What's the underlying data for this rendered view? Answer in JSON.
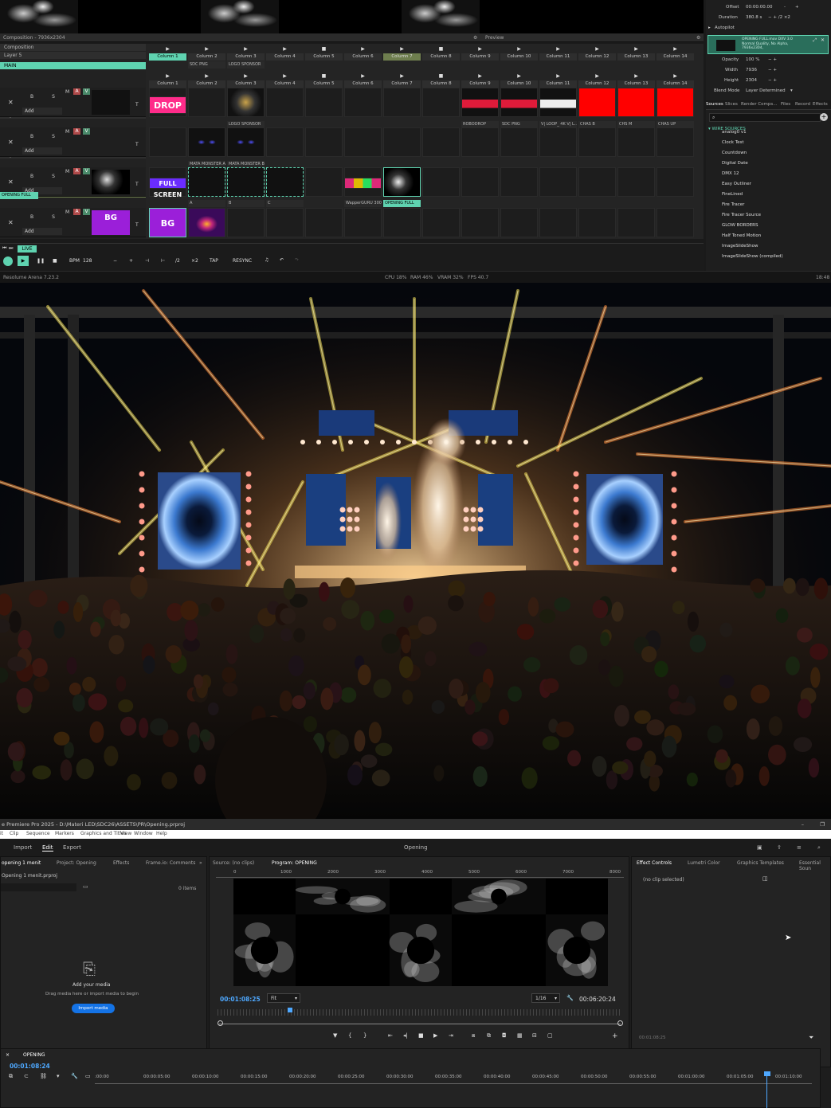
{
  "resolume": {
    "composition_title": "Composition - 7936x2304",
    "preview_label": "Preview",
    "composition_label": "Composition",
    "layers": [
      {
        "bar": "Layer 5",
        "type": "normal"
      },
      {
        "bar": "MAIN",
        "type": "main"
      },
      {
        "bar": "Layer 4",
        "type": "normal"
      },
      {
        "bar": "Layer 3",
        "type": "normal"
      },
      {
        "bar": "Layer 2",
        "type": "l2"
      }
    ],
    "layer_controls": {
      "b": "B",
      "s": "S",
      "x": "✕",
      "add": "Add",
      "m": "M",
      "a": "A",
      "v": "V",
      "t": "T",
      "alph": "Alph"
    },
    "columns": [
      "Column 1",
      "Column 2",
      "Column 3",
      "Column 4",
      "Column 5",
      "Column 6",
      "Column 7",
      "Column 8",
      "Column 9",
      "Column 10",
      "Column 11",
      "Column 12",
      "Column 13",
      "Column 14"
    ],
    "clip_labels_row0": [
      "",
      "SDC PNG",
      "LOGO SPONSOR"
    ],
    "clip_labels_row1": [
      "",
      "",
      "LOGO SPONSOR",
      "",
      "",
      "",
      "",
      "",
      "ROBODROP",
      "SDC PNG",
      "V| LOOP_ 4K V| L...",
      "CHAS B",
      "CHS M",
      "CHAS UP"
    ],
    "clip_labels_row2": [
      "",
      "MATA MONSTER A",
      "MATA MONSTER B"
    ],
    "clip_labels_row3": [
      "",
      "A",
      "B",
      "C",
      "",
      "WapperGURU 300...",
      "OPENING FULL"
    ],
    "clip_text": {
      "drop": "DROP",
      "fullscreen": "FULL SCREEN",
      "bg": "BG"
    },
    "layer_thumbs": {
      "opening_full": "OPENING FULL",
      "bg": "BG"
    },
    "transport": {
      "live": "LIVE",
      "bpm_label": "BPM",
      "bpm": "128",
      "minus": "−",
      "plus": "+",
      "div2": "/2",
      "x2": "×2",
      "tap": "TAP",
      "resync": "RESYNC"
    },
    "status": {
      "version": "Resolume Arena 7.23.2",
      "cpu": "CPU 18%",
      "ram": "RAM 46%",
      "vram": "VRAM 32%",
      "fps": "FPS 40.7",
      "time": "18:48"
    },
    "right_panel": {
      "offset_label": "Offset",
      "offset": "00:00:00.00",
      "duration_label": "Duration",
      "duration": "380.8 s",
      "autopilot": "Autopilot",
      "clip_info": "OPENING FULL.mov DXV 3.0 Normal Quality, No Alpha, 7936x2304,",
      "opacity_label": "Opacity",
      "opacity": "100 %",
      "width_label": "Width",
      "width": "7936",
      "height_label": "Height",
      "height": "2304",
      "blend_label": "Blend Mode",
      "blend": "Layer Determined",
      "tabs": [
        "Sources",
        "Slices",
        "Render Comps...",
        "Files",
        "Record",
        "Effects"
      ],
      "group": "WIRE SOURCES",
      "sources": [
        "analog0 v1",
        "Clock Test",
        "Countdown",
        "Digital Date",
        "DMX 12",
        "Easy Outliner",
        "FineLined",
        "Fire Tracer",
        "Fire Tracer Source",
        "GLOW BORDERS",
        "Half Toned Motion",
        "ImageSlideShow",
        "ImageSlideShow (compiled)"
      ]
    }
  },
  "premiere": {
    "title": "e Premiere Pro 2025 - D:\\Materi LED\\SDC26\\ASSETS\\PR\\Opening.prproj",
    "menu": [
      "it",
      "Clip",
      "Sequence",
      "Markers",
      "Graphics and Titles",
      "View",
      "Window",
      "Help"
    ],
    "header_tabs": [
      "Import",
      "Edit",
      "Export"
    ],
    "project_name": "Opening",
    "left_tabs": [
      "opening 1 menit",
      "Project: Opening",
      "Effects",
      "Frame.io: Comments"
    ],
    "project_file": "Opening 1 menit.prproj",
    "items": "0 items",
    "add_media": "Add your media",
    "drag_hint": "Drag media here or import media to begin",
    "import_button": "Import media",
    "source_tab": "Source: (no clips)",
    "program_tab": "Program: OPENING",
    "program_timecode": "00:01:08:25",
    "fit": "Fit",
    "resolution": "1/16",
    "duration_tc": "00:06:20:24",
    "ruler": [
      "0",
      "1000",
      "2000",
      "3000",
      "4000",
      "5000",
      "6000",
      "7000",
      "8000"
    ],
    "right_tabs": [
      "Effect Controls",
      "Lumetri Color",
      "Graphics Templates",
      "Essential Soun"
    ],
    "no_clip": "(no clip selected)",
    "ec_time": "00:01:08:25",
    "seq_tab": "OPENING",
    "seq_tc": "00:01:08:24",
    "time_ruler": [
      ":00:00",
      "00:00:05:00",
      "00:00:10:00",
      "00:00:15:00",
      "00:00:20:00",
      "00:00:25:00",
      "00:00:30:00",
      "00:00:35:00",
      "00:00:40:00",
      "00:00:45:00",
      "00:00:50:00",
      "00:00:55:00",
      "00:01:00:00",
      "00:01:05:00",
      "00:01:10:00"
    ]
  },
  "colors": {
    "accent": "#5fd3b0",
    "drop_pink": "#ff2c8a",
    "bg_purple": "#9b1fd9",
    "red_clip": "#ff0000",
    "premiere_blue": "#1473e6"
  }
}
